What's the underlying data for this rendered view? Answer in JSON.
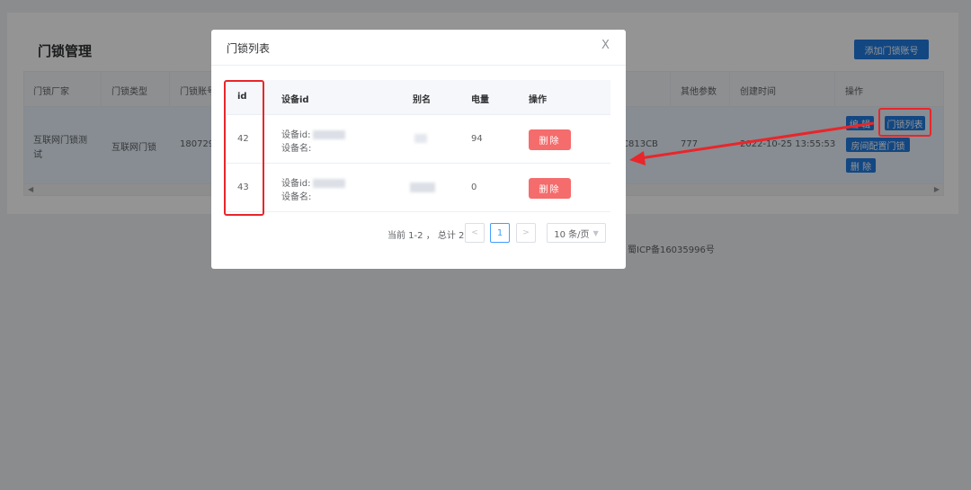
{
  "background": {
    "page_title": "门锁管理",
    "add_button": "添加门锁账号",
    "table": {
      "headers": [
        "门锁厂家",
        "门锁类型",
        "门锁账号",
        "其他参数",
        "创建时间",
        "操作"
      ],
      "row": {
        "vendor_line1": "互联网门锁测",
        "vendor_line2": "试",
        "type": "互联网门锁",
        "account": "1807295",
        "hidden_partial": "C813CB",
        "other_params": "777",
        "created": "2022-10-25 13:55:53"
      },
      "actions": {
        "edit": "编 辑",
        "lock_list": "门锁列表",
        "room_config": "房间配置门锁",
        "delete": "删 除"
      }
    },
    "icp": "蜀ICP备16035996号"
  },
  "dialog": {
    "title": "门锁列表",
    "close": "X",
    "columns": {
      "id": "id",
      "device_id": "设备id",
      "alias": "别名",
      "battery": "电量",
      "action": "操作"
    },
    "rows": [
      {
        "id": "42",
        "device_id_label": "设备id:",
        "device_name_label": "设备名:",
        "battery": "94",
        "delete_label": "删除"
      },
      {
        "id": "43",
        "device_id_label": "设备id:",
        "device_name_label": "设备名:",
        "battery": "0",
        "delete_label": "删除"
      }
    ],
    "pagination": {
      "total_text": "当前 1-2 ， 总计 2",
      "prev": "<",
      "current_page": "1",
      "next": ">",
      "page_size": "10 条/页"
    }
  },
  "colors": {
    "primary": "#1f7ae0",
    "danger": "#f56c6c",
    "annotation": "#e8262b"
  }
}
